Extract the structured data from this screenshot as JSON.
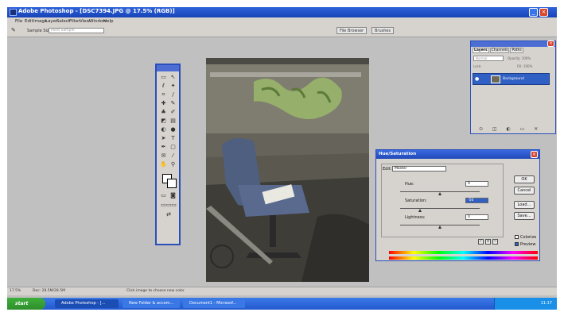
{
  "window": {
    "title": "Adobe Photoshop - [DSC7394.JPG @ 17.5% (RGB)]"
  },
  "menu": [
    "File",
    "Edit",
    "Image",
    "Layer",
    "Select",
    "Filter",
    "View",
    "Window",
    "Help"
  ],
  "options": {
    "sample_size_label": "Sample Size:",
    "sample_size_value": "Point Sample",
    "tabs": [
      "File Browser",
      "Brushes"
    ]
  },
  "layers_panel": {
    "tabs": [
      "Layers",
      "Channels",
      "Paths"
    ],
    "mode": "Normal",
    "opacity_label": "Opacity: 100%",
    "lock_label": "Lock:",
    "fill_label": "Fill: 100%",
    "layer_name": "Background"
  },
  "hue_saturation": {
    "title": "Hue/Saturation",
    "edit_label": "Edit:",
    "edit_value": "Master",
    "hue_label": "Hue:",
    "hue_value": "0",
    "saturation_label": "Saturation:",
    "saturation_value": "-50",
    "lightness_label": "Lightness:",
    "lightness_value": "0",
    "buttons": {
      "ok": "OK",
      "cancel": "Cancel",
      "load": "Load...",
      "save": "Save..."
    },
    "colorize_label": "Colorize",
    "preview_label": "Preview",
    "colorize_checked": false,
    "preview_checked": true
  },
  "status": {
    "zoom": "17.5%",
    "doc": "Doc: 28.5M/28.5M",
    "hint": "Click image to choose new color"
  },
  "taskbar": {
    "start": "start",
    "tasks": [
      "Adobe Photoshop - [...",
      "New Folder & accom...",
      "Document1 - Microsof..."
    ],
    "clock": "11:17"
  }
}
